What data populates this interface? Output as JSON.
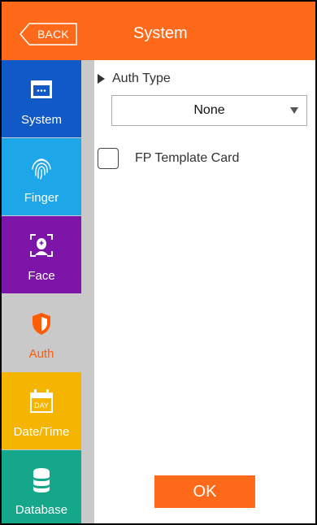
{
  "header": {
    "back_label": "BACK",
    "title": "System"
  },
  "sidebar": {
    "items": [
      {
        "label": "System",
        "icon": "window-icon",
        "color": "#1059c7"
      },
      {
        "label": "Finger",
        "icon": "fingerprint-icon",
        "color": "#1ea7e8"
      },
      {
        "label": "Face",
        "icon": "face-scan-icon",
        "color": "#7d16a8"
      },
      {
        "label": "Auth",
        "icon": "shield-icon",
        "color": "#ff5c0a",
        "selected": true
      },
      {
        "label": "Date/Time",
        "icon": "calendar-icon",
        "color": "#f4b400",
        "day_text": "DAY"
      },
      {
        "label": "Database",
        "icon": "database-icon",
        "color": "#14a789"
      }
    ]
  },
  "main": {
    "auth_type_label": "Auth Type",
    "auth_type_value": "None",
    "fp_template_label": "FP Template Card",
    "fp_template_checked": false,
    "ok_label": "OK"
  },
  "colors": {
    "accent": "#ff6a1a"
  }
}
